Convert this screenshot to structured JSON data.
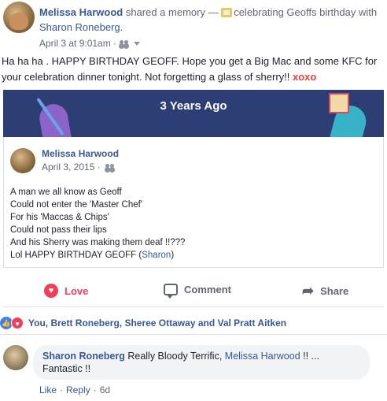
{
  "header": {
    "author": "Melissa Harwood",
    "action_text": " shared a memory — ",
    "memory_label": "celebrating Geoffs birthday with",
    "with_name": "Sharon Roneberg",
    "end": ".",
    "timestamp": "April 3 at 9:01am ·"
  },
  "post": {
    "text": "Ha ha ha . HAPPY BIRTHDAY GEOFF. Hope you get a Big Mac and some KFC for your celebration dinner tonight. Not forgetting a glass of sherry!!",
    "xo": "xoxo"
  },
  "memory": {
    "banner_title": "3 Years Ago",
    "author": "Melissa Harwood",
    "date": "April 3, 2015 ·",
    "poem_lines": [
      "A man we all know as Geoff",
      "Could not enter the 'Master Chef'",
      "For his 'Maccas & Chips'",
      "Could not pass their lips",
      "And his Sherry was making them deaf !!???"
    ],
    "last_line_prefix": "Lol HAPPY BIRTHDAY GEOFF (",
    "last_line_name": "Sharon",
    "last_line_suffix": ")"
  },
  "actions": {
    "love": "Love",
    "comment": "Comment",
    "share": "Share"
  },
  "reactions": {
    "names": "You, Brett Roneberg, Sheree Ottaway and Val Pratt Aitken"
  },
  "comment": {
    "author": "Sharon Roneberg",
    "text_before": " Really Bloody Terrific, ",
    "mention": "Melissa Harwood",
    "text_after": " !! ... Fantastic !!",
    "like": "Like",
    "reply": "Reply",
    "sep": "·",
    "age": "6d"
  },
  "colors": {
    "link": "#365899",
    "love": "#f33e58",
    "banner": "#2c3e73"
  }
}
